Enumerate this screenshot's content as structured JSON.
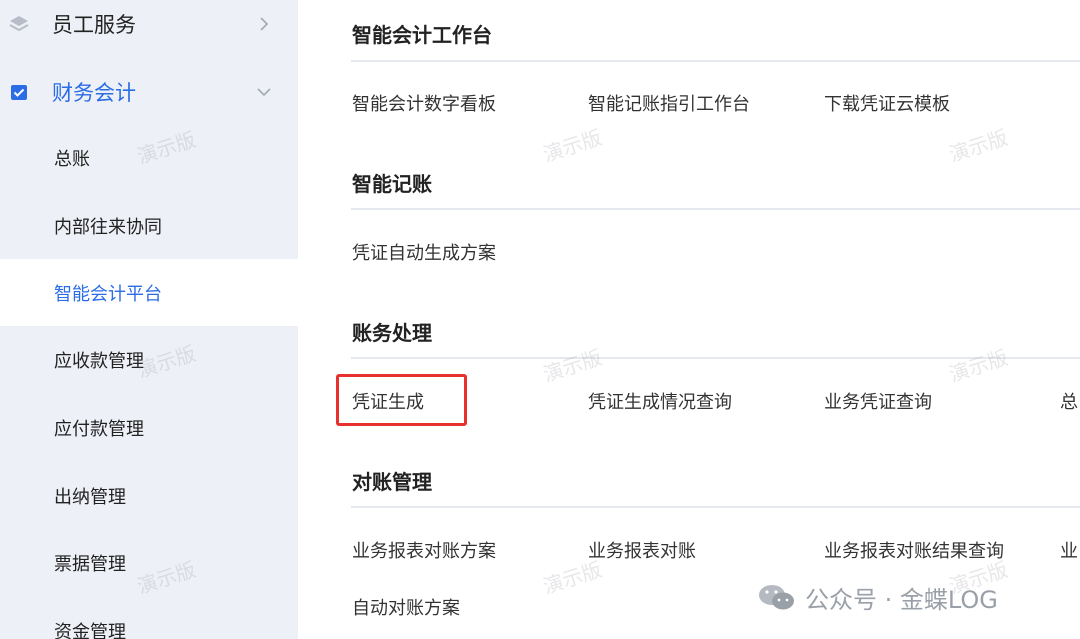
{
  "sidebar": {
    "groups": [
      {
        "label": "员工服务",
        "icon": "layers-icon",
        "state": "collapsed"
      },
      {
        "label": "财务会计",
        "icon": "checkbox-icon",
        "state": "expanded"
      }
    ],
    "items": [
      {
        "label": "总账"
      },
      {
        "label": "内部往来协同"
      },
      {
        "label": "智能会计平台",
        "active": true
      },
      {
        "label": "应收款管理"
      },
      {
        "label": "应付款管理"
      },
      {
        "label": "出纳管理"
      },
      {
        "label": "票据管理"
      },
      {
        "label": "资金管理"
      }
    ]
  },
  "sections": [
    {
      "title": "智能会计工作台",
      "links": [
        "智能会计数字看板",
        "智能记账指引工作台",
        "下载凭证云模板"
      ]
    },
    {
      "title": "智能记账",
      "links": [
        "凭证自动生成方案"
      ]
    },
    {
      "title": "账务处理",
      "links": [
        "凭证生成",
        "凭证生成情况查询",
        "业务凭证查询",
        "总"
      ]
    },
    {
      "title": "对账管理",
      "links": [
        "业务报表对账方案",
        "业务报表对账",
        "业务报表对账结果查询",
        "业",
        "自动对账方案"
      ]
    }
  ],
  "watermark": "演示版",
  "footer": {
    "official_account": "公众号 · 金蝶LOG",
    "icon": "wechat-icon"
  },
  "colors": {
    "accent": "#2b6de5",
    "highlight": "#e8312f",
    "sidebar_bg": "#eef0f7"
  }
}
